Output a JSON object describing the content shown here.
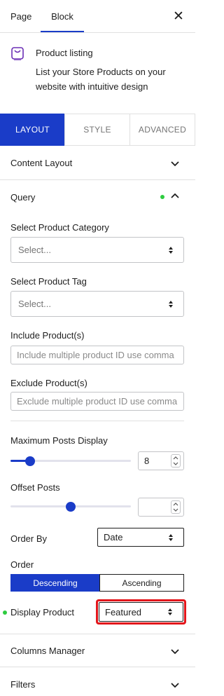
{
  "top_tabs": [
    {
      "label": "Page"
    },
    {
      "label": "Block"
    }
  ],
  "block": {
    "title": "Product listing",
    "description": "List your Store Products on your website with intuitive design"
  },
  "panel_tabs": [
    {
      "label": "LAYOUT"
    },
    {
      "label": "STYLE"
    },
    {
      "label": "ADVANCED"
    }
  ],
  "sections": {
    "content_layout": "Content Layout",
    "query": "Query",
    "columns_manager": "Columns Manager",
    "filters": "Filters"
  },
  "query": {
    "category_label": "Select Product Category",
    "category_value": "Select...",
    "tag_label": "Select Product Tag",
    "tag_value": "Select...",
    "include_label": "Include Product(s)",
    "include_placeholder": "Include multiple product ID use comma",
    "exclude_label": "Exclude Product(s)",
    "exclude_placeholder": "Exclude multiple product ID use comma",
    "max_posts_label": "Maximum Posts Display",
    "max_posts_value": "8",
    "max_posts_level": 0.13,
    "offset_label": "Offset Posts",
    "offset_value": "",
    "offset_level": 0.5,
    "order_by_label": "Order By",
    "order_by_value": "Date",
    "order_label": "Order",
    "order_options": [
      "Descending",
      "Ascending"
    ],
    "display_product_label": "Display Product",
    "display_product_value": "Featured"
  },
  "colors": {
    "accent": "#1a3cc8",
    "status_dot": "#2ecc40",
    "highlight": "#e3151b"
  }
}
